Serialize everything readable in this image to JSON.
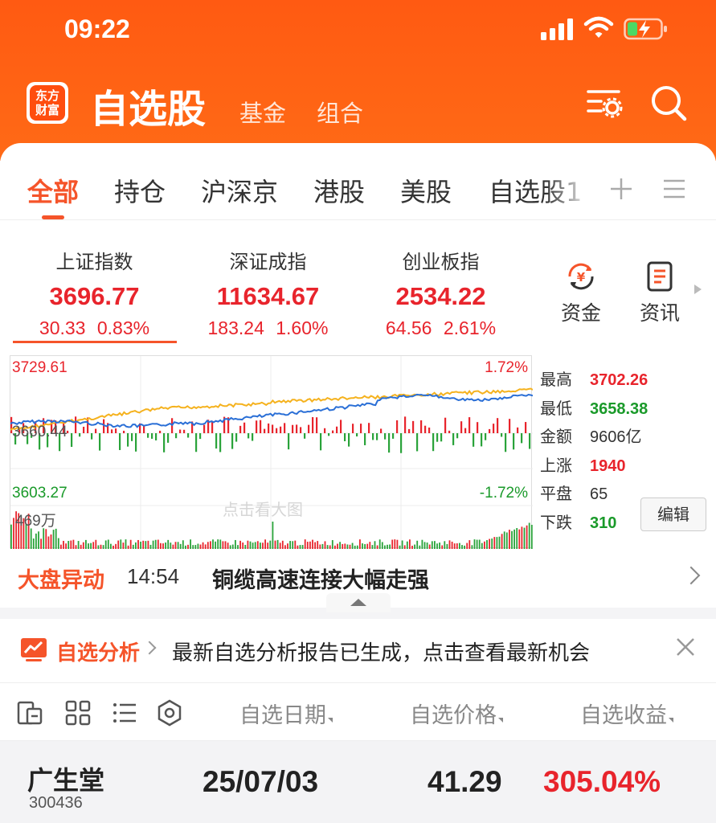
{
  "status_bar": {
    "time": "09:22"
  },
  "header": {
    "logo_text_line1": "东方",
    "logo_text_line2": "财富",
    "title": "自选股",
    "links": [
      "基金",
      "组合"
    ]
  },
  "tabs": [
    "全部",
    "持仓",
    "沪深京",
    "港股",
    "美股",
    "自选股1"
  ],
  "indices": [
    {
      "name": "上证指数",
      "value": "3696.77",
      "change": "30.33 0.83%"
    },
    {
      "name": "深证成指",
      "value": "11634.67",
      "change": "183.24 1.60%"
    },
    {
      "name": "创业板指",
      "value": "2534.22",
      "change": "64.56 2.61%"
    }
  ],
  "side_buttons": [
    {
      "label": "资金",
      "icon": "yuan-refresh-icon"
    },
    {
      "label": "资讯",
      "icon": "news-icon"
    }
  ],
  "chart": {
    "high_label": "3729.61",
    "mid_label": "3660.44",
    "low_label": "3603.27",
    "pct_up": "1.72%",
    "pct_down": "-1.72%",
    "volume_label": "469万",
    "watermark": "点击看大图"
  },
  "stats": [
    {
      "key": "最高",
      "value": "3702.26",
      "color": "#e8242c"
    },
    {
      "key": "最低",
      "value": "3658.38",
      "color": "#1a9a2a"
    },
    {
      "key": "金额",
      "value": "9606亿",
      "color": "#333333"
    },
    {
      "key": "上涨",
      "value": "1940",
      "color": "#e8242c"
    },
    {
      "key": "平盘",
      "value": "65",
      "color": "#333333"
    },
    {
      "key": "下跌",
      "value": "310",
      "color": "#1a9a2a"
    }
  ],
  "edit_label": "编辑",
  "market_move": {
    "label": "大盘异动",
    "time": "14:54",
    "text": "铜缆高速连接大幅走强"
  },
  "analysis": {
    "label": "自选分析",
    "text": "最新自选分析报告已生成，点击查看最新机会"
  },
  "list_columns": [
    "自选日期",
    "自选价格",
    "自选收益"
  ],
  "stocks": [
    {
      "name": "广生堂",
      "code": "300436",
      "date": "25/07/03",
      "price": "41.29",
      "return": "305.04%"
    }
  ],
  "colors": {
    "accent": "#f5542a",
    "header": "#ff5a12",
    "up": "#e8242c",
    "down": "#1a9a2a"
  }
}
